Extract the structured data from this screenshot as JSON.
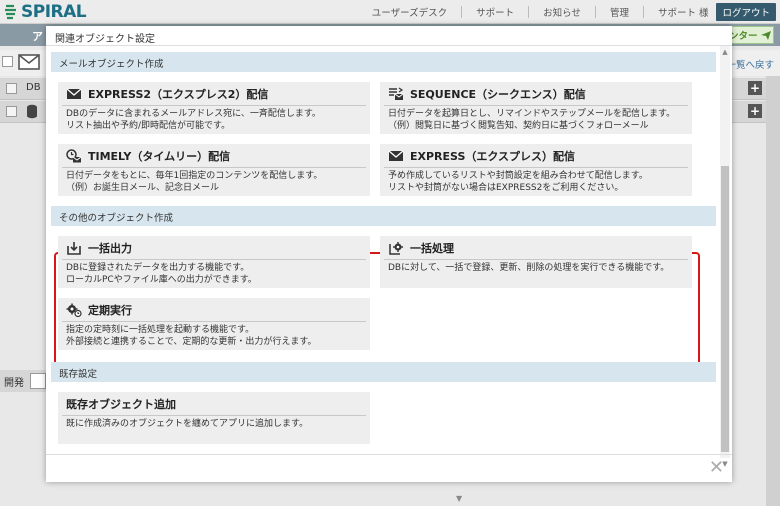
{
  "app": {
    "logo": "SPIRAL",
    "nav": [
      "ユーザーズデスク",
      "サポート",
      "お知らせ",
      "管理",
      "サポート 様"
    ],
    "logout": "ログアウト",
    "bg_title": "ア",
    "green_button": "ンター",
    "list_link": "一覧へ戻す",
    "rows": [
      {
        "label": "DB"
      },
      {
        "label": ""
      }
    ],
    "dev_label": "開発"
  },
  "modal": {
    "title": "関連オブジェクト設定",
    "sections": [
      {
        "title": "メールオブジェクト作成",
        "cards": [
          {
            "icon": "envelope-icon",
            "title": "EXPRESS2（エクスプレス2）配信",
            "desc": "DBのデータに含まれるメールアドレス宛に、一斉配信します。\nリスト抽出や予約/即時配信が可能です。"
          },
          {
            "icon": "sequence-icon",
            "title": "SEQUENCE（シークエンス）配信",
            "desc": "日付データを起算日とし、リマインドやステップメールを配信します。\n（例）閲覧日に基づく閲覧告知、契約日に基づくフォローメール"
          },
          {
            "icon": "timely-icon",
            "title": "TIMELY（タイムリー）配信",
            "desc": "日付データをもとに、毎年1回指定のコンテンツを配信します。\n（例）お誕生日メール、記念日メール"
          },
          {
            "icon": "envelope-icon",
            "title": "EXPRESS（エクスプレス）配信",
            "desc": "予め作成しているリストや封筒設定を組み合わせて配信します。\nリストや封筒がない場合はEXPRESS2をご利用ください。"
          }
        ]
      },
      {
        "title": "その他のオブジェクト作成",
        "cards": [
          {
            "icon": "export-icon",
            "title": "一括出力",
            "desc": "DBに登録されたデータを出力する機能です。\nローカルPCやファイル庫への出力ができます。"
          },
          {
            "icon": "batch-process-icon",
            "title": "一括処理",
            "desc": "DBに対して、一括で登録、更新、削除の処理を実行できる機能です。"
          },
          {
            "icon": "scheduled-run-icon",
            "title": "定期実行",
            "desc": "指定の定時刻に一括処理を起動する機能です。\n外部接続と連携することで、定期的な更新・出力が行えます。"
          }
        ]
      },
      {
        "title": "既存設定",
        "cards": [
          {
            "icon": "",
            "title": "既存オブジェクト追加",
            "desc": "既に作成済みのオブジェクトを纏めてアプリに追加します。"
          }
        ]
      }
    ],
    "close": "✕"
  },
  "colors": {
    "highlight": "#d81818",
    "section_bg": "#d7e6ee",
    "card_bg": "#eeeeee",
    "logout_bg": "#355a6e"
  }
}
